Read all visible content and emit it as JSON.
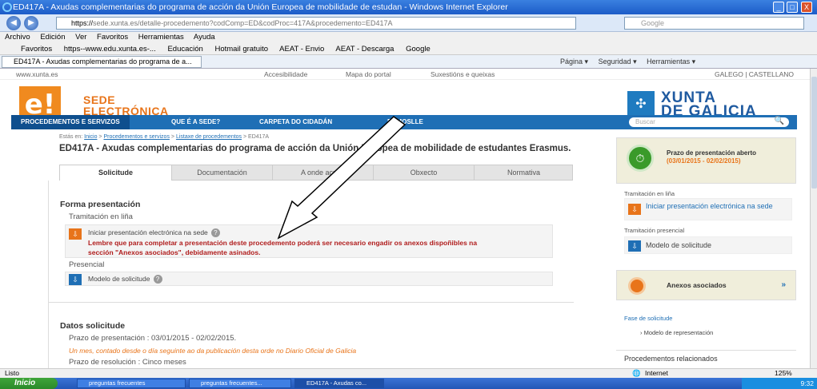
{
  "window": {
    "title": "ED417A - Axudas complementarias do programa de acción da Unión Europea de mobilidade de estudan - Windows Internet Explorer",
    "controls": [
      "_",
      "□",
      "X"
    ]
  },
  "address": {
    "url_prefix": "https://",
    "url_rest": "sede.xunta.es/detalle-procedemento?codComp=ED&codProc=417A&procedemento=ED417A",
    "search_placeholder": "Google"
  },
  "menu": [
    "Archivo",
    "Edición",
    "Ver",
    "Favoritos",
    "Herramientas",
    "Ayuda"
  ],
  "favorites": [
    "Favoritos",
    "https--www.edu.xunta.es-...",
    "Educación",
    "Hotmail gratuito",
    "AEAT - Envio",
    "AEAT - Descarga",
    "Google"
  ],
  "ie_tab": "ED417A - Axudas complementarias do programa de a...",
  "commands": [
    "Página ▾",
    "Seguridad ▾",
    "Herramientas ▾"
  ],
  "toplinks": {
    "site": "www.xunta.es",
    "access": "Accesibilidade",
    "map": "Mapa do portal",
    "suggest": "Suxestións e queixas",
    "lang": "GALEGO | CASTELLANO"
  },
  "header": {
    "logo_e": "e!",
    "sede_line1": "SEDE",
    "sede_line2": "ELECTRÓNICA",
    "xunta_line1": "XUNTA",
    "xunta_line2": "DE GALICIA"
  },
  "nav": {
    "items": [
      "PROCEDEMENTOS E SERVIZOS",
      "QUE É A SEDE?",
      "CARPETA DO CIDADÁN",
      "DÁMOSLLE"
    ],
    "search_placeholder": "Buscar"
  },
  "breadcrumb": {
    "prefix": "Estás en:",
    "inicio": "Inicio",
    "proc": "Procedementos e servizos",
    "listaxe": "Listaxe de procedementos",
    "current": "> ED417A"
  },
  "page_title": "ED417A - Axudas complementarias do programa de acción da Unión Europea de mobilidade de estudantes Erasmus.",
  "tabs": [
    "Solicitude",
    "Documentación",
    "A onde acudir",
    "Obxecto",
    "Normativa"
  ],
  "form": {
    "title": "Forma presentación",
    "online_label": "Tramitación en liña",
    "online_link": "Iniciar presentación electrónica na sede",
    "warning": "Lembre que para completar a presentación deste procedemento poderá ser necesario engadir os anexos dispoñibles na sección \"Anexos asociados\", debidamente asinados.",
    "presencial_label": "Presencial",
    "presencial_link": "Modelo de solicitude"
  },
  "datos": {
    "title": "Datos solicitude",
    "prazo": "Prazo de presentación : 03/01/2015 - 02/02/2015.",
    "note": "Un mes, contado desde o día seguinte ao da publicación desta orde no Diario Oficial de Galicia",
    "resolucion": "Prazo de resolución : Cinco meses"
  },
  "sidebar": {
    "prazo_title": "Prazo de presentación aberto",
    "prazo_dates": "(03/01/2015 - 02/02/2015)",
    "online_label": "Tramitación en liña",
    "online_link": "Iniciar presentación electrónica na sede",
    "presencial_label": "Tramitación presencial",
    "presencial_link": "Modelo de solicitude",
    "annexos": "Anexos asociados",
    "annexos_chevron": "»",
    "fase_label": "Fase de solicitude",
    "fase_link": "Modelo de representación",
    "related": "Procedementos relacionados"
  },
  "status": {
    "left": "Listo",
    "zone": "Internet",
    "zoom": "125%"
  },
  "taskbar": {
    "start": "Inicio",
    "buttons": [
      "preguntas frecuentes",
      "preguntas frecuentes...",
      "ED417A - Axudas co..."
    ],
    "clock": "9:32"
  }
}
